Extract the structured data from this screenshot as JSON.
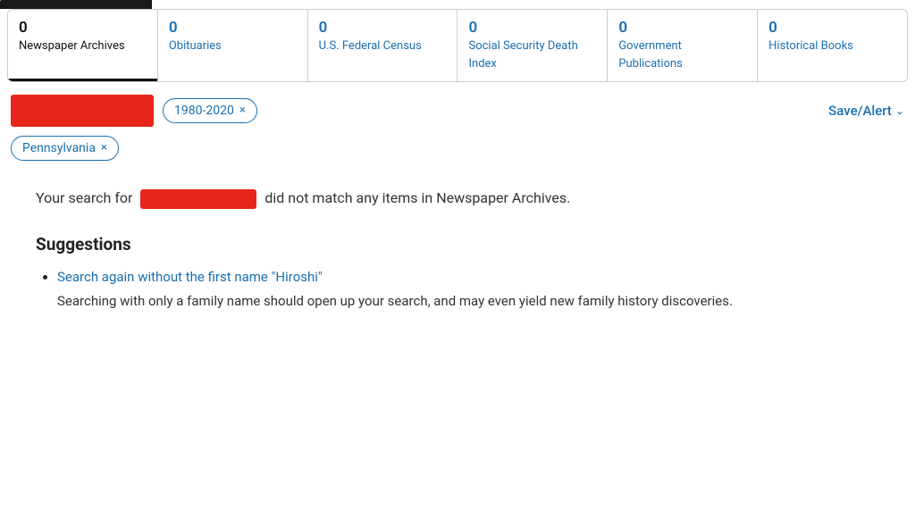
{
  "topBar": {
    "color": "#111"
  },
  "tabs": [
    {
      "id": "newspaper-archives",
      "count": "0",
      "label": "Newspaper Archives",
      "active": true
    },
    {
      "id": "obituaries",
      "count": "0",
      "label": "Obituaries",
      "active": false
    },
    {
      "id": "us-federal-census",
      "count": "0",
      "label": "U.S. Federal Census",
      "active": false
    },
    {
      "id": "social-security-death-index",
      "count": "0",
      "label": "Social Security Death Index",
      "active": false
    },
    {
      "id": "government-publications",
      "count": "0",
      "label": "Government Publications",
      "active": false
    },
    {
      "id": "historical-books",
      "count": "0",
      "label": "Historical Books",
      "active": false
    }
  ],
  "filters": {
    "dateRange": {
      "label": "1980-2020",
      "closeLabel": "×"
    },
    "location": {
      "label": "Pennsylvania",
      "closeLabel": "×"
    },
    "saveAlert": "Save/Alert"
  },
  "results": {
    "noMatchText1": "Your search for",
    "noMatchText2": "did not match any items in Newspaper Archives."
  },
  "suggestions": {
    "heading": "Suggestions",
    "items": [
      {
        "linkText": "Search again without the first name \"Hiroshi\"",
        "description": "Searching with only a family name should open up your search, and may even yield new family history discoveries."
      }
    ]
  }
}
